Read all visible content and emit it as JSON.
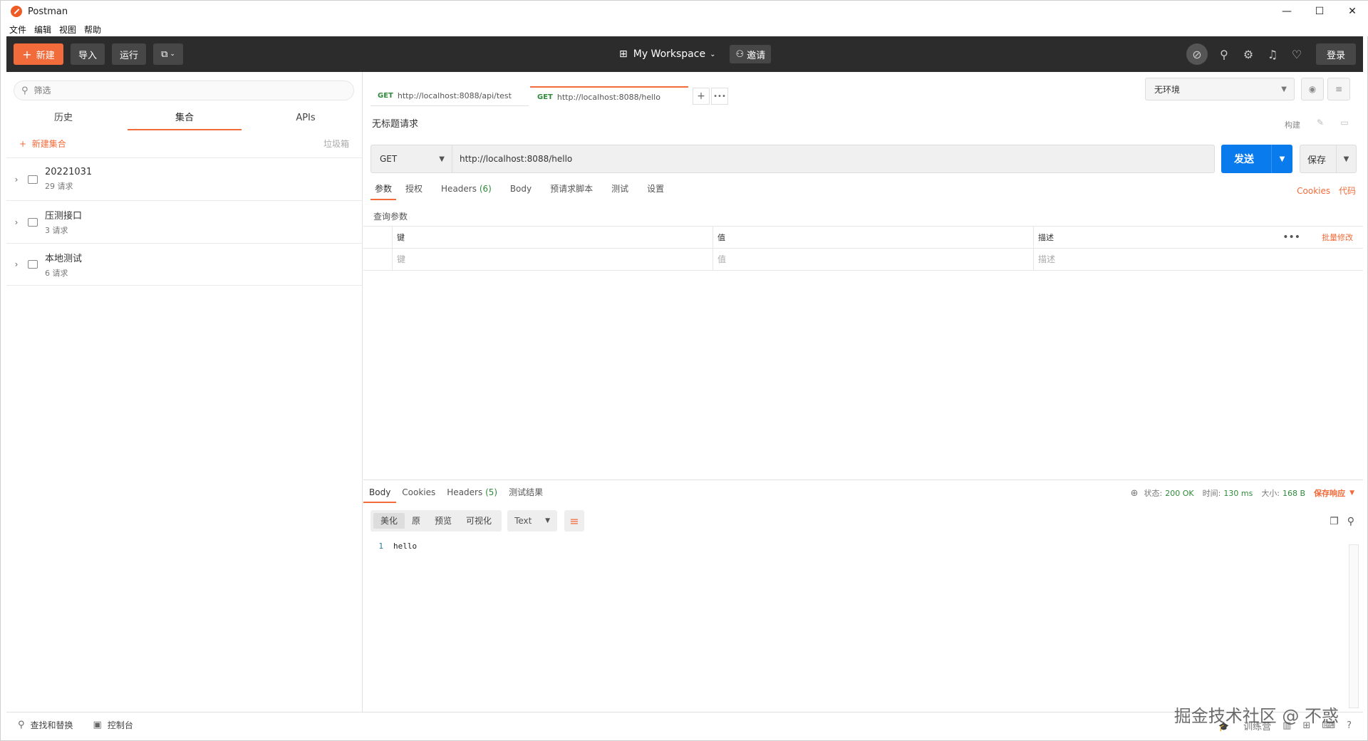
{
  "app": {
    "title": "Postman"
  },
  "window_controls": {
    "min": "—",
    "max": "☐",
    "close": "✕"
  },
  "menu": [
    "文件",
    "编辑",
    "视图",
    "帮助"
  ],
  "header": {
    "new_label": "新建",
    "import_label": "导入",
    "runner_label": "运行",
    "workspace_label": "My Workspace",
    "invite_label": "邀请",
    "login_label": "登录"
  },
  "sidebar": {
    "filter_placeholder": "筛选",
    "tabs": [
      "历史",
      "集合",
      "APIs"
    ],
    "active_tab": "集合",
    "new_collection_label": "新建集合",
    "trash_label": "垃圾箱",
    "collections": [
      {
        "name": "20221031",
        "count": "29 请求"
      },
      {
        "name": "压测接口",
        "count": "3 请求"
      },
      {
        "name": "本地测试",
        "count": "6 请求"
      }
    ]
  },
  "request_tabs": [
    {
      "method": "GET",
      "url": "http://localhost:8088/api/test"
    },
    {
      "method": "GET",
      "url": "http://localhost:8088/hello"
    }
  ],
  "environment": {
    "selected": "无环境"
  },
  "request": {
    "name": "无标题请求",
    "build_label": "构建",
    "method": "GET",
    "url": "http://localhost:8088/hello",
    "send_label": "发送",
    "save_label": "保存"
  },
  "request_sections": {
    "params": "参数",
    "auth": "授权",
    "headers": "Headers",
    "headers_count": "(6)",
    "body": "Body",
    "prerequest": "预请求脚本",
    "tests": "测试",
    "settings": "设置",
    "cookies": "Cookies",
    "code": "代码"
  },
  "params": {
    "title": "查询参数",
    "columns": [
      "键",
      "值",
      "描述"
    ],
    "placeholders": [
      "键",
      "值",
      "描述"
    ],
    "more": "•••",
    "bulk_edit": "批量修改"
  },
  "response": {
    "tabs": {
      "body": "Body",
      "cookies": "Cookies",
      "headers": "Headers",
      "headers_count": "(5)",
      "tests": "测试结果"
    },
    "status_label": "状态:",
    "status_value": "200 OK",
    "time_label": "时间:",
    "time_value": "130 ms",
    "size_label": "大小:",
    "size_value": "168 B",
    "save_label": "保存响应",
    "format_options": [
      "美化",
      "原",
      "预览",
      "可视化"
    ],
    "active_format": "美化",
    "language": "Text",
    "lines": [
      {
        "n": "1",
        "text": "hello"
      }
    ]
  },
  "footer": {
    "find_replace": "查找和替换",
    "console": "控制台",
    "bootcamp": "训练营"
  },
  "watermark": "掘金技术社区 @ 不惑",
  "colors": {
    "accent": "#f26b3a",
    "send": "#097bed",
    "header_bg": "#2c2c2c",
    "success": "#2f8a3b"
  }
}
